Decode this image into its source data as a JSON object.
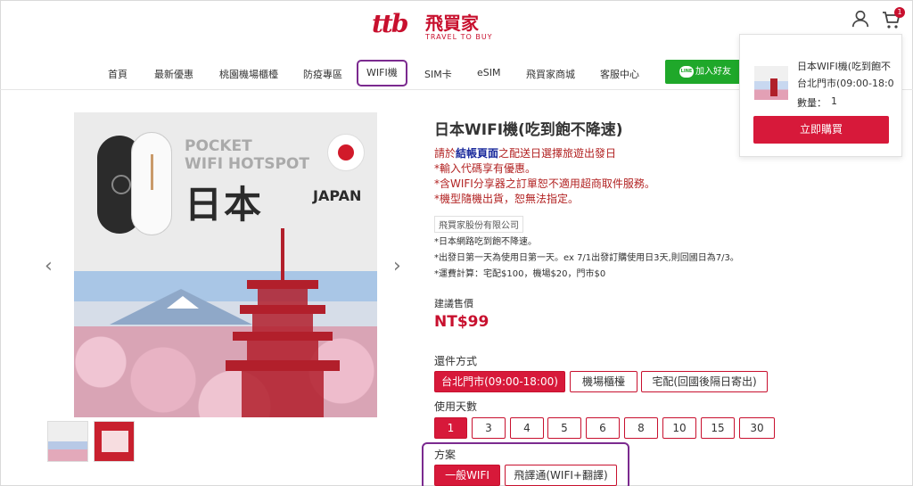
{
  "header": {
    "logo_mark": "ttb",
    "logo_brand": "飛買家",
    "logo_sub": "TRAVEL TO BUY",
    "cart_count": "1"
  },
  "nav": {
    "items": [
      "首頁",
      "最新優惠",
      "桃園機場櫃檯",
      "防疫專區",
      "WIFI機",
      "SIM卡",
      "eSIM",
      "飛買家商城",
      "客服中心"
    ],
    "line_button": "加入好友",
    "line_logo": "LINE"
  },
  "cart_popup": {
    "item_name": "日本WIFI機(吃到飽不",
    "item_option": "台北門市(09:00-18:0",
    "qty_label": "數量：",
    "qty": "1",
    "buy_button": "立即購買"
  },
  "product_image": {
    "pocket_line1": "POCKET",
    "pocket_line2": "WIFI HOTSPOT",
    "japan_zh": "日本",
    "japan_en": "JAPAN"
  },
  "product": {
    "title": "日本WIFI機(吃到飽不降速)",
    "note1_pre": "請於",
    "note1_link": "結帳頁面",
    "note1_post": "之配送日選擇旅遊出發日",
    "note2": "*輸入代碼享有優惠。",
    "note3": "*含WIFI分享器之訂單恕不適用超商取件服務。",
    "note4": "*機型隨機出貨，恕無法指定。",
    "seller": "飛買家股份有限公司",
    "desc1": "*日本網路吃到飽不降速。",
    "desc2": "*出發日第一天為使用日第一天。ex 7/1出發訂購使用日3天,則回國日為7/3。",
    "desc3": "*運費計算：宅配$100，機場$20，門市$0",
    "price_label": "建議售價",
    "price": "NT$99"
  },
  "return_method": {
    "label": "還件方式",
    "options": [
      "台北門市(09:00-18:00)",
      "機場櫃檯",
      "宅配(回國後隔日寄出)"
    ],
    "selected": 0
  },
  "days": {
    "label": "使用天數",
    "options": [
      "1",
      "3",
      "4",
      "5",
      "6",
      "8",
      "10",
      "15",
      "30"
    ],
    "selected": 0
  },
  "plan": {
    "label": "方案",
    "options": [
      "一般WIFI",
      "飛譯通(WIFI+翻譯)"
    ],
    "selected": 0
  },
  "colors": {
    "brand_red": "#c8102e",
    "highlight_purple": "#7b2a8f",
    "line_green": "#1fa82a"
  }
}
